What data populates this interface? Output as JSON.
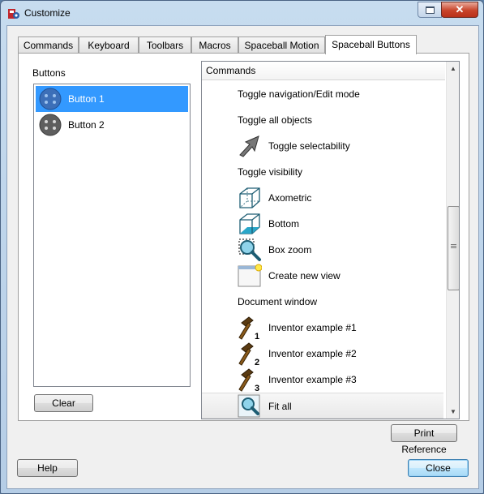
{
  "window": {
    "title": "Customize",
    "close_glyph": "✕"
  },
  "tabs": [
    {
      "label": "Commands"
    },
    {
      "label": "Keyboard"
    },
    {
      "label": "Toolbars"
    },
    {
      "label": "Macros"
    },
    {
      "label": "Spaceball Motion"
    },
    {
      "label": "Spaceball Buttons",
      "active": true
    }
  ],
  "buttons_panel": {
    "label": "Buttons",
    "items": [
      {
        "label": "Button 1",
        "selected": true,
        "icon": "spaceball-button-icon"
      },
      {
        "label": "Button 2",
        "selected": false,
        "icon": "spaceball-button-icon"
      }
    ],
    "clear_label": "Clear"
  },
  "commands_panel": {
    "header": "Commands",
    "items": [
      {
        "type": "category",
        "label": "Toggle navigation/Edit mode"
      },
      {
        "type": "category",
        "label": "Toggle all objects"
      },
      {
        "type": "command",
        "label": "Toggle selectability",
        "icon": "arrow-cursor-icon"
      },
      {
        "type": "category",
        "label": "Toggle visibility"
      },
      {
        "type": "command",
        "label": "Axometric",
        "icon": "axometric-cube-icon"
      },
      {
        "type": "command",
        "label": "Bottom",
        "icon": "bottom-view-cube-icon"
      },
      {
        "type": "command",
        "label": "Box zoom",
        "icon": "box-zoom-icon"
      },
      {
        "type": "command",
        "label": "Create new view",
        "icon": "new-view-icon"
      },
      {
        "type": "category",
        "label": "Document window"
      },
      {
        "type": "command",
        "label": "Inventor example #1",
        "icon": "hammer-1-icon"
      },
      {
        "type": "command",
        "label": "Inventor example #2",
        "icon": "hammer-2-icon"
      },
      {
        "type": "command",
        "label": "Inventor example #3",
        "icon": "hammer-3-icon"
      },
      {
        "type": "command",
        "label": "Fit all",
        "icon": "fit-all-icon",
        "hover": true
      }
    ]
  },
  "print_reference_label": "Print Reference",
  "help_label": "Help",
  "close_label": "Close",
  "scroll_arrows": {
    "up": "▲",
    "down": "▼"
  },
  "colors": {
    "selection": "#3399ff",
    "accent_cyan": "#2aa7c9",
    "titlebar": "#c7dcef"
  }
}
